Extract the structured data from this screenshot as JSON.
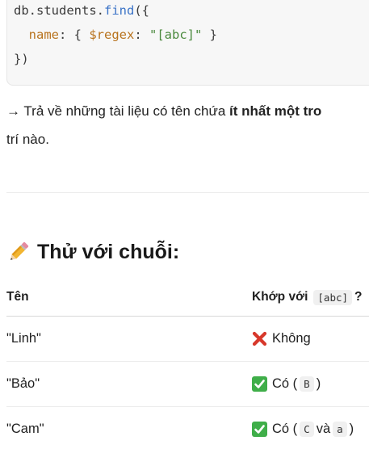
{
  "code": {
    "line1": {
      "obj": "db.students.",
      "method": "find",
      "tail": "({"
    },
    "line2": {
      "indent": "  ",
      "key": "name",
      "colon": ": { ",
      "op": "$regex",
      "colon2": ": ",
      "str": "\"[abc]\"",
      "close": " }"
    },
    "line3": {
      "text": "})"
    }
  },
  "explanation": {
    "prefix": "→ Trả về những tài liệu có tên chứa ",
    "bold": "ít nhất một tro",
    "line2": "trí nào."
  },
  "section": {
    "heading": "Thử với chuỗi:",
    "icon": "pencil-icon"
  },
  "table": {
    "headers": {
      "col1": "Tên",
      "col2_prefix": "Khớp với",
      "col2_code": "[abc]",
      "col2_suffix": "?"
    },
    "rows": [
      {
        "name": "\"Linh\"",
        "status_icon": "cross-mark-icon",
        "result": "Không"
      },
      {
        "name": "\"Bảo\"",
        "status_icon": "check-mark-icon",
        "result": "Có (",
        "code1": "B",
        "close": ")"
      },
      {
        "name": "\"Cam\"",
        "status_icon": "check-mark-icon",
        "result": "Có (",
        "code1": "C",
        "mid": "và",
        "code2": "a",
        "close": ")"
      }
    ]
  },
  "colors": {
    "check_bg": "#3fae49",
    "cross": "#d7382b",
    "code_bg": "#f7f7f7"
  }
}
